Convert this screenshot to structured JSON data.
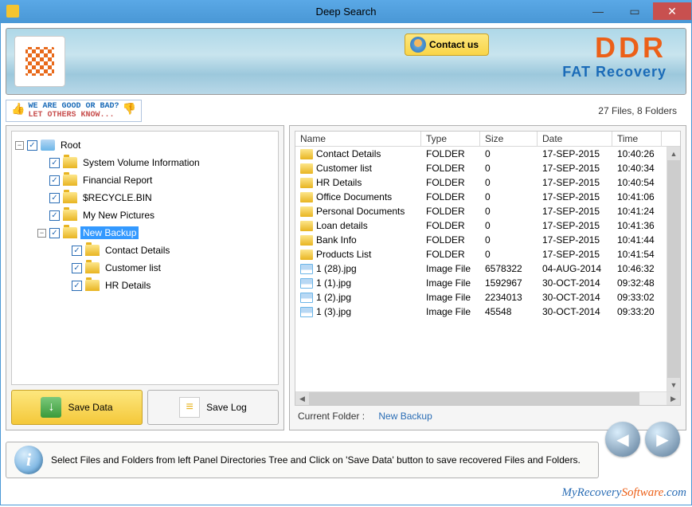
{
  "titlebar": {
    "title": "Deep Search"
  },
  "header": {
    "contact_label": "Contact us",
    "brand_name": "DDR",
    "brand_sub": "FAT Recovery"
  },
  "rating": {
    "line1": "WE ARE GOOD OR BAD?",
    "line2": "LET OTHERS KNOW..."
  },
  "status": {
    "summary": "27 Files, 8 Folders"
  },
  "tree": {
    "root": "Root",
    "items": [
      {
        "label": "System Volume Information"
      },
      {
        "label": "Financial Report"
      },
      {
        "label": "$RECYCLE.BIN"
      },
      {
        "label": "My New Pictures"
      },
      {
        "label": "New Backup"
      },
      {
        "label": "Contact Details"
      },
      {
        "label": "Customer list"
      },
      {
        "label": "HR Details"
      }
    ]
  },
  "actions": {
    "save_data": "Save Data",
    "save_log": "Save Log"
  },
  "list": {
    "headers": {
      "name": "Name",
      "type": "Type",
      "size": "Size",
      "date": "Date",
      "time": "Time"
    },
    "rows": [
      {
        "icon": "folder",
        "name": "Contact Details",
        "type": "FOLDER",
        "size": "0",
        "date": "17-SEP-2015",
        "time": "10:40:26"
      },
      {
        "icon": "folder",
        "name": "Customer list",
        "type": "FOLDER",
        "size": "0",
        "date": "17-SEP-2015",
        "time": "10:40:34"
      },
      {
        "icon": "folder",
        "name": "HR Details",
        "type": "FOLDER",
        "size": "0",
        "date": "17-SEP-2015",
        "time": "10:40:54"
      },
      {
        "icon": "folder",
        "name": "Office Documents",
        "type": "FOLDER",
        "size": "0",
        "date": "17-SEP-2015",
        "time": "10:41:06"
      },
      {
        "icon": "folder",
        "name": "Personal Documents",
        "type": "FOLDER",
        "size": "0",
        "date": "17-SEP-2015",
        "time": "10:41:24"
      },
      {
        "icon": "folder",
        "name": "Loan details",
        "type": "FOLDER",
        "size": "0",
        "date": "17-SEP-2015",
        "time": "10:41:36"
      },
      {
        "icon": "folder",
        "name": "Bank Info",
        "type": "FOLDER",
        "size": "0",
        "date": "17-SEP-2015",
        "time": "10:41:44"
      },
      {
        "icon": "folder",
        "name": "Products List",
        "type": "FOLDER",
        "size": "0",
        "date": "17-SEP-2015",
        "time": "10:41:54"
      },
      {
        "icon": "image",
        "name": "1 (28).jpg",
        "type": "Image File",
        "size": "6578322",
        "date": "04-AUG-2014",
        "time": "10:46:32"
      },
      {
        "icon": "image",
        "name": "1 (1).jpg",
        "type": "Image File",
        "size": "1592967",
        "date": "30-OCT-2014",
        "time": "09:32:48"
      },
      {
        "icon": "image",
        "name": "1 (2).jpg",
        "type": "Image File",
        "size": "2234013",
        "date": "30-OCT-2014",
        "time": "09:33:02"
      },
      {
        "icon": "image",
        "name": "1 (3).jpg",
        "type": "Image File",
        "size": "45548",
        "date": "30-OCT-2014",
        "time": "09:33:20"
      }
    ]
  },
  "current_folder": {
    "label": "Current Folder :",
    "value": "New Backup"
  },
  "hint": {
    "text": "Select Files and Folders from left Panel Directories Tree and Click on 'Save Data' button to save recovered Files and Folders."
  },
  "footer_link": {
    "a": "MyRecovery",
    "b": "Software",
    "c": ".com"
  }
}
